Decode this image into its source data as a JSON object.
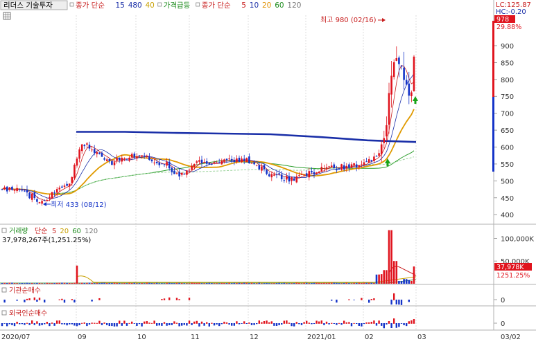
{
  "header": {
    "stock_name": "리더스 기술투자",
    "legends": [
      {
        "text": "종가 단순",
        "color": "#c81e1e"
      },
      {
        "text": "15",
        "color": "#1a2fa8"
      },
      {
        "text": "480",
        "color": "#1a2fa8"
      },
      {
        "text": "40",
        "color": "#c8a000"
      },
      {
        "text": "가격급등",
        "color": "#1e8c1e"
      },
      {
        "text": "종가 단순",
        "color": "#c81e1e"
      },
      {
        "text": "5",
        "color": "#c81e1e"
      },
      {
        "text": "10",
        "color": "#1a2fa8"
      },
      {
        "text": "20",
        "color": "#e09000"
      },
      {
        "text": "60",
        "color": "#1e8c1e"
      },
      {
        "text": "120",
        "color": "#777777"
      }
    ],
    "lc_label": "LC:125.87",
    "hc_label": "HC:-0.20"
  },
  "price_panel": {
    "last_price_label": "978",
    "change_pct_label": "29.88%",
    "high_annotation": "최고 980 (02/16)",
    "low_annotation": "최저 433 (08/12)"
  },
  "volume_panel": {
    "legend_title": "거래량",
    "legend_items": [
      {
        "text": "단순",
        "color": "#c81e1e"
      },
      {
        "text": "5",
        "color": "#c81e1e"
      },
      {
        "text": "20",
        "color": "#c8a000"
      },
      {
        "text": "60",
        "color": "#1e8c1e"
      },
      {
        "text": "120",
        "color": "#777777"
      }
    ],
    "volume_value_label": "37,978,267주(1,251.25%)",
    "last_volume_badge": "37,978K",
    "last_volume_pct": "1251.25%"
  },
  "institution_panel": {
    "title": "기관순매수",
    "zero_label": "0"
  },
  "foreign_panel": {
    "title": "외국인순매수",
    "zero_label": "0"
  },
  "x_axis_labels": [
    "2020/07",
    "09",
    "10",
    "11",
    "12",
    "2021/01",
    "02",
    "03",
    "03/02"
  ],
  "colors": {
    "up": "#e0141e",
    "down": "#1433c8",
    "ma480": "#1a2fa8",
    "ma40": "#e09a00"
  },
  "chart_data": [
    {
      "type": "candlestick",
      "title": "리더스 기술투자",
      "y_ticks": [
        400,
        450,
        500,
        550,
        600,
        650,
        700,
        750,
        800,
        850,
        900
      ],
      "ylim": [
        380,
        990
      ],
      "x_range": [
        "2020-07",
        "2021-03"
      ],
      "annotations": [
        {
          "text": "최고 980 (02/16)",
          "value": 980
        },
        {
          "text": "최저 433 (08/12)",
          "value": 433
        }
      ],
      "series": [
        {
          "name": "480",
          "type": "line",
          "approx_values": [
            645,
            645,
            642,
            640,
            638,
            630,
            620,
            615
          ]
        },
        {
          "name": "40",
          "type": "line",
          "approx_values": [
            470,
            540,
            570,
            560,
            560,
            520,
            560,
            700
          ]
        }
      ],
      "last_close": 978,
      "change_pct": 29.88
    },
    {
      "type": "bar",
      "title": "거래량",
      "y_ticks": [
        0,
        50000,
        100000
      ],
      "y_tick_labels": [
        "",
        "50,000K",
        "100,000K"
      ],
      "last_volume": 37978267,
      "last_volume_pct": 1251.25
    }
  ]
}
